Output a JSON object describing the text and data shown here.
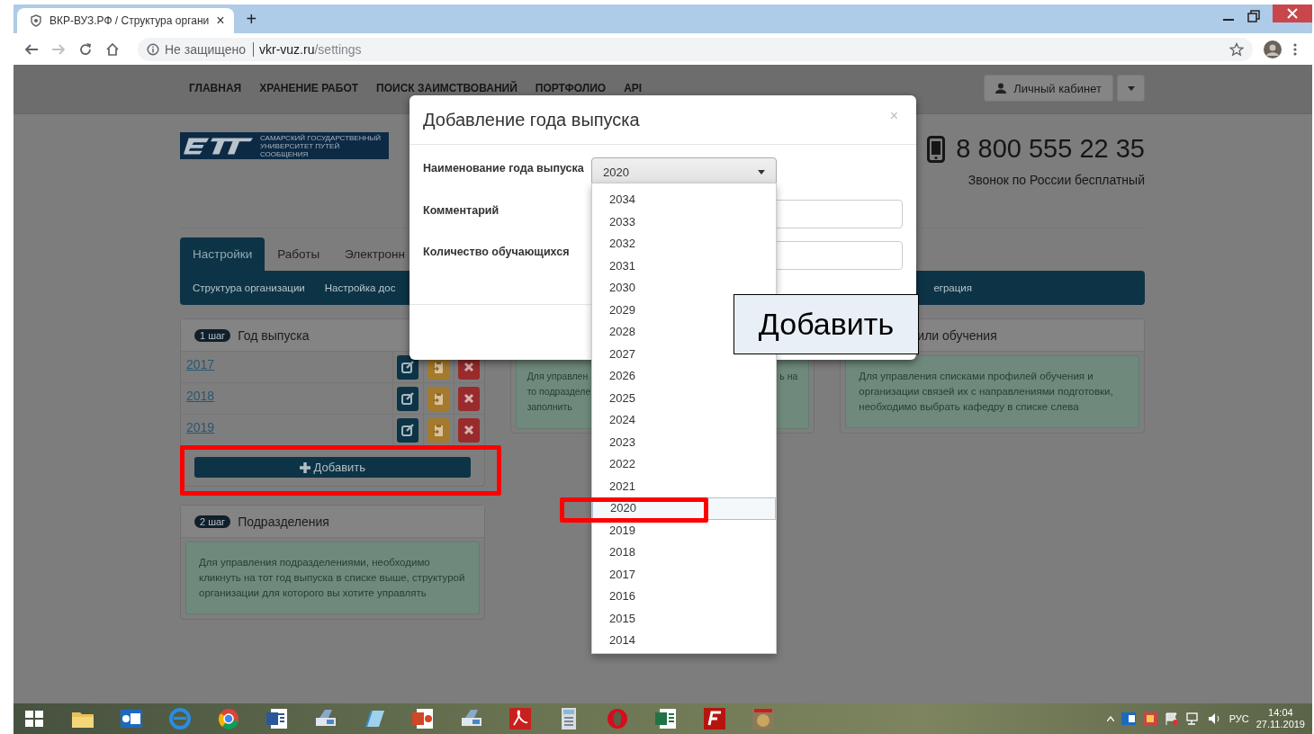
{
  "browser": {
    "tab": {
      "title": "ВКР-ВУЗ.РФ / Структура органи",
      "close": "×",
      "selected": true
    },
    "new_tab": "+",
    "security": "Не защищено",
    "url_host": "vkr-vuz.ru",
    "url_path": "/settings"
  },
  "nav": {
    "items": [
      "ГЛАВНАЯ",
      "ХРАНЕНИЕ РАБОТ",
      "ПОИСК ЗАИМСТВОВАНИЙ",
      "ПОРТФОЛИО",
      "API"
    ],
    "account": "Личный кабинет"
  },
  "logo": {
    "caption": "САМАРСКИЙ ГОСУДАРСТВЕННЫЙ УНИВЕРСИТЕТ ПУТЕЙ СООБЩЕНИЯ"
  },
  "contact": {
    "phone": "8 800 555 22 35",
    "note": "Звонок по России бесплатный"
  },
  "tabs": [
    {
      "label": "Настройки",
      "selected": true
    },
    {
      "label": "Работы",
      "selected": false
    },
    {
      "label": "Электронн",
      "selected": false
    }
  ],
  "subnav": [
    "Структура организации",
    "Настройка дос",
    "еграция"
  ],
  "years_card": {
    "step": "1 шаг",
    "title": "Год выпуска",
    "rows": [
      "2017",
      "2018",
      "2019"
    ],
    "add_button": "Добавить"
  },
  "units_card": {
    "step": "2 шаг",
    "title": "Подразделения",
    "info": "Для управления подразделениями, необходимо кликнуть на тот год выпуска в списке выше, структурой организации для которого вы хотите управлять"
  },
  "middle_card": {
    "info_lines": [
      "Для управлен",
      "то подразделе",
      "заполнить"
    ],
    "info_tail": "ь на"
  },
  "right_card": {
    "title": "или обучения",
    "info": "Для управления списками профилей обучения и организации связей их с направлениями подготовки, необходимо выбрать кафедру в списке слева"
  },
  "modal": {
    "title": "Добавление года выпуска",
    "close": "×",
    "fields": [
      {
        "kind": "select",
        "label": "Наименование года выпуска",
        "value": "2020"
      },
      {
        "kind": "text",
        "label": "Комментарий"
      },
      {
        "kind": "text",
        "label": "Количество обучающихся"
      }
    ]
  },
  "dropdown": {
    "options": [
      {
        "label": "2034",
        "selected": false
      },
      {
        "label": "2033",
        "selected": false
      },
      {
        "label": "2032",
        "selected": false
      },
      {
        "label": "2031",
        "selected": false
      },
      {
        "label": "2030",
        "selected": false
      },
      {
        "label": "2029",
        "selected": false
      },
      {
        "label": "2028",
        "selected": false
      },
      {
        "label": "2027",
        "selected": false
      },
      {
        "label": "2026",
        "selected": false
      },
      {
        "label": "2025",
        "selected": false
      },
      {
        "label": "2024",
        "selected": false
      },
      {
        "label": "2023",
        "selected": false
      },
      {
        "label": "2022",
        "selected": false
      },
      {
        "label": "2021",
        "selected": false
      },
      {
        "label": "2020",
        "selected": true
      },
      {
        "label": "2019",
        "selected": false
      },
      {
        "label": "2018",
        "selected": false
      },
      {
        "label": "2017",
        "selected": false
      },
      {
        "label": "2016",
        "selected": false
      },
      {
        "label": "2015",
        "selected": false
      },
      {
        "label": "2014",
        "selected": false
      }
    ]
  },
  "callout": {
    "text": "Добавить"
  },
  "taskbar": {
    "language": "РУС",
    "time": "14:04",
    "date": "27.11.2019"
  }
}
